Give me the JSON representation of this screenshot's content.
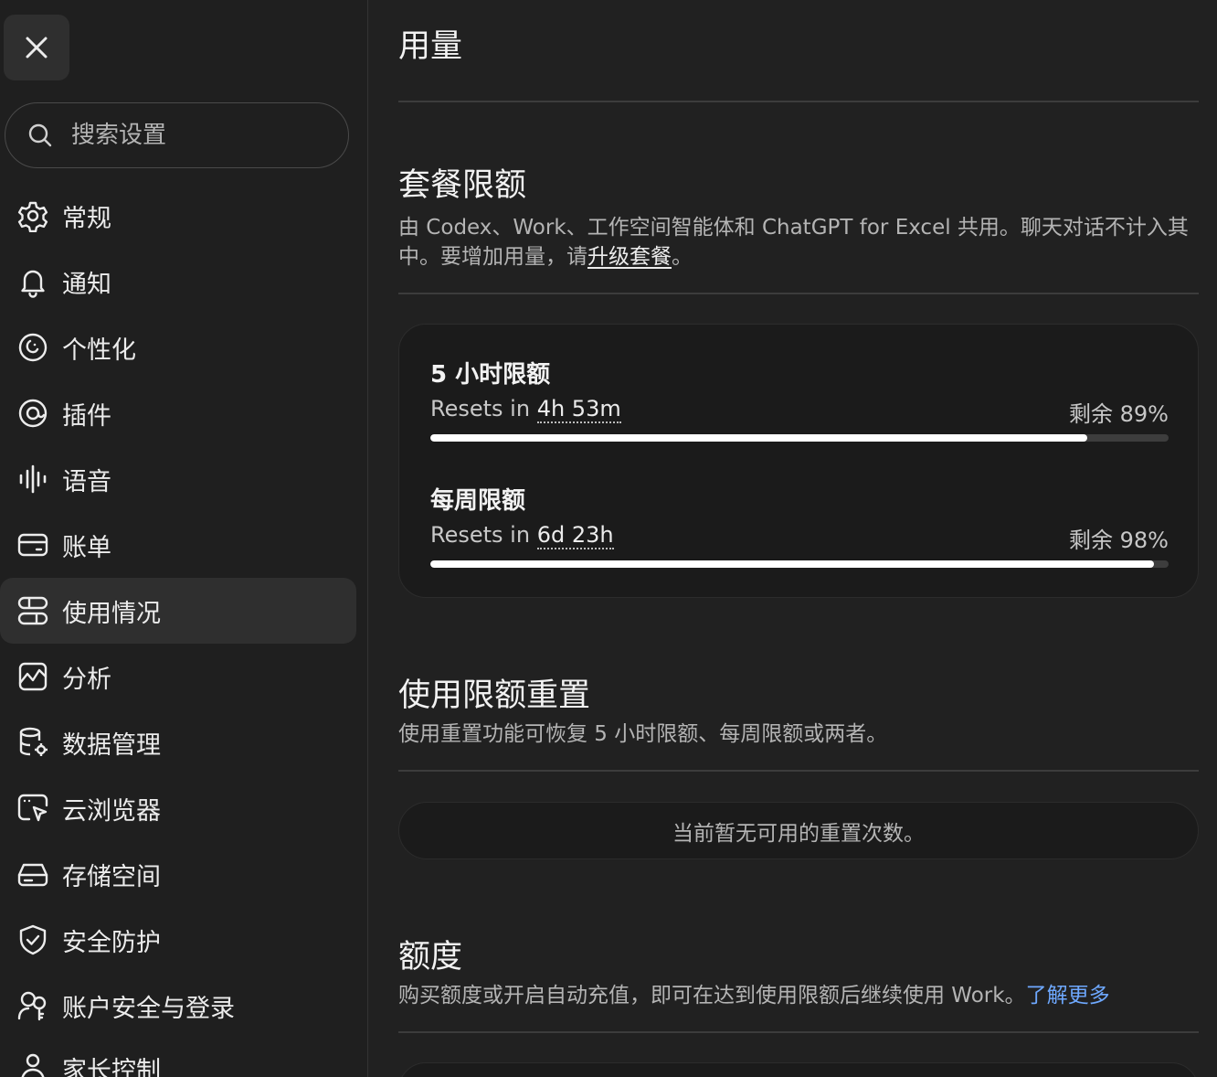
{
  "sidebar": {
    "close_icon": "close-icon",
    "search": {
      "placeholder": "搜索设置",
      "value": ""
    },
    "items": [
      {
        "label": "常规",
        "icon": "gear-icon"
      },
      {
        "label": "通知",
        "icon": "bell-icon"
      },
      {
        "label": "个性化",
        "icon": "personalization-icon"
      },
      {
        "label": "插件",
        "icon": "plugin-icon"
      },
      {
        "label": "语音",
        "icon": "waveform-icon"
      },
      {
        "label": "账单",
        "icon": "credit-card-icon"
      },
      {
        "label": "使用情况",
        "icon": "usage-icon",
        "active": true
      },
      {
        "label": "分析",
        "icon": "analytics-icon"
      },
      {
        "label": "数据管理",
        "icon": "database-settings-icon"
      },
      {
        "label": "云浏览器",
        "icon": "cloud-browser-icon"
      },
      {
        "label": "存储空间",
        "icon": "storage-icon"
      },
      {
        "label": "安全防护",
        "icon": "shield-icon"
      },
      {
        "label": "账户安全与登录",
        "icon": "account-security-icon"
      },
      {
        "label": "家长控制",
        "icon": "parental-control-icon"
      }
    ]
  },
  "main": {
    "title": "用量",
    "plan": {
      "title": "套餐限额",
      "desc_prefix": "由 Codex、Work、工作空间智能体和 ChatGPT for Excel 共用。聊天对话不计入其中。要增加用量，请",
      "desc_link": "升级套餐",
      "desc_suffix": "。",
      "limits": [
        {
          "name": "5 小时限额",
          "reset_prefix": "Resets in ",
          "reset_value": "4h 53m",
          "remaining_label": "剩余 89%",
          "remaining_fraction": 0.89
        },
        {
          "name": "每周限额",
          "reset_prefix": "Resets in ",
          "reset_value": "6d 23h",
          "remaining_label": "剩余 98%",
          "remaining_fraction": 0.98
        }
      ]
    },
    "reset": {
      "title": "使用限额重置",
      "desc": "使用重置功能可恢复 5 小时限额、每周限额或两者。",
      "empty_text": "当前暂无可用的重置次数。"
    },
    "credits": {
      "title": "额度",
      "desc": "购买额度或开启自动充值，即可在达到使用限额后继续使用 Work。",
      "link": "了解更多"
    }
  },
  "colors": {
    "background": "#212121",
    "sidebar": "#1f1f1f",
    "accent_link": "#6ea8fe",
    "bar_fill": "#ffffff"
  }
}
